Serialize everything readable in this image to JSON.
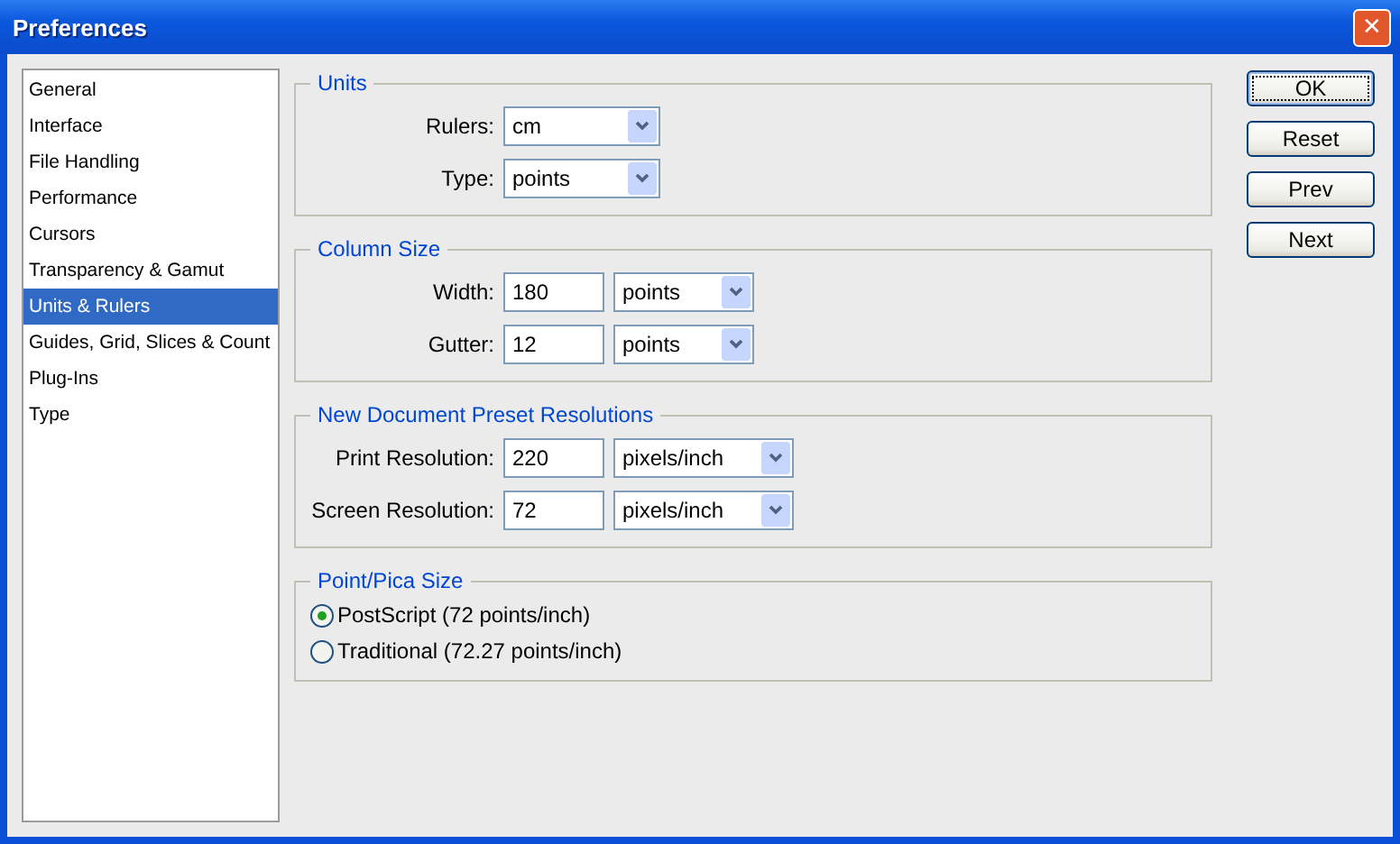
{
  "window": {
    "title": "Preferences",
    "close_label": "✕"
  },
  "sidebar": {
    "items": [
      {
        "label": "General",
        "selected": false
      },
      {
        "label": "Interface",
        "selected": false
      },
      {
        "label": "File Handling",
        "selected": false
      },
      {
        "label": "Performance",
        "selected": false
      },
      {
        "label": "Cursors",
        "selected": false
      },
      {
        "label": "Transparency & Gamut",
        "selected": false
      },
      {
        "label": "Units & Rulers",
        "selected": true
      },
      {
        "label": "Guides, Grid, Slices & Count",
        "selected": false
      },
      {
        "label": "Plug-Ins",
        "selected": false
      },
      {
        "label": "Type",
        "selected": false
      }
    ]
  },
  "groups": [
    {
      "title": "Units",
      "kind": "fields",
      "rows": [
        {
          "label": "Rulers:",
          "unit": "cm"
        },
        {
          "label": "Type:",
          "unit": "points"
        }
      ]
    },
    {
      "title": "Column Size",
      "kind": "fields",
      "rows": [
        {
          "label": "Width:",
          "value": "180",
          "unit": "points"
        },
        {
          "label": "Gutter:",
          "value": "12",
          "unit": "points"
        }
      ]
    },
    {
      "title": "New Document Preset Resolutions",
      "kind": "fields",
      "rows": [
        {
          "label": "Print Resolution:",
          "value": "220",
          "unit": "pixels/inch"
        },
        {
          "label": "Screen Resolution:",
          "value": "72",
          "unit": "pixels/inch"
        }
      ]
    },
    {
      "title": "Point/Pica Size",
      "kind": "radios",
      "options": [
        {
          "label": "PostScript (72 points/inch)",
          "selected": true
        },
        {
          "label": "Traditional (72.27 points/inch)",
          "selected": false
        }
      ]
    }
  ],
  "buttons": [
    {
      "label": "OK",
      "focused": true
    },
    {
      "label": "Reset",
      "focused": false
    },
    {
      "label": "Prev",
      "focused": false
    },
    {
      "label": "Next",
      "focused": false
    }
  ]
}
